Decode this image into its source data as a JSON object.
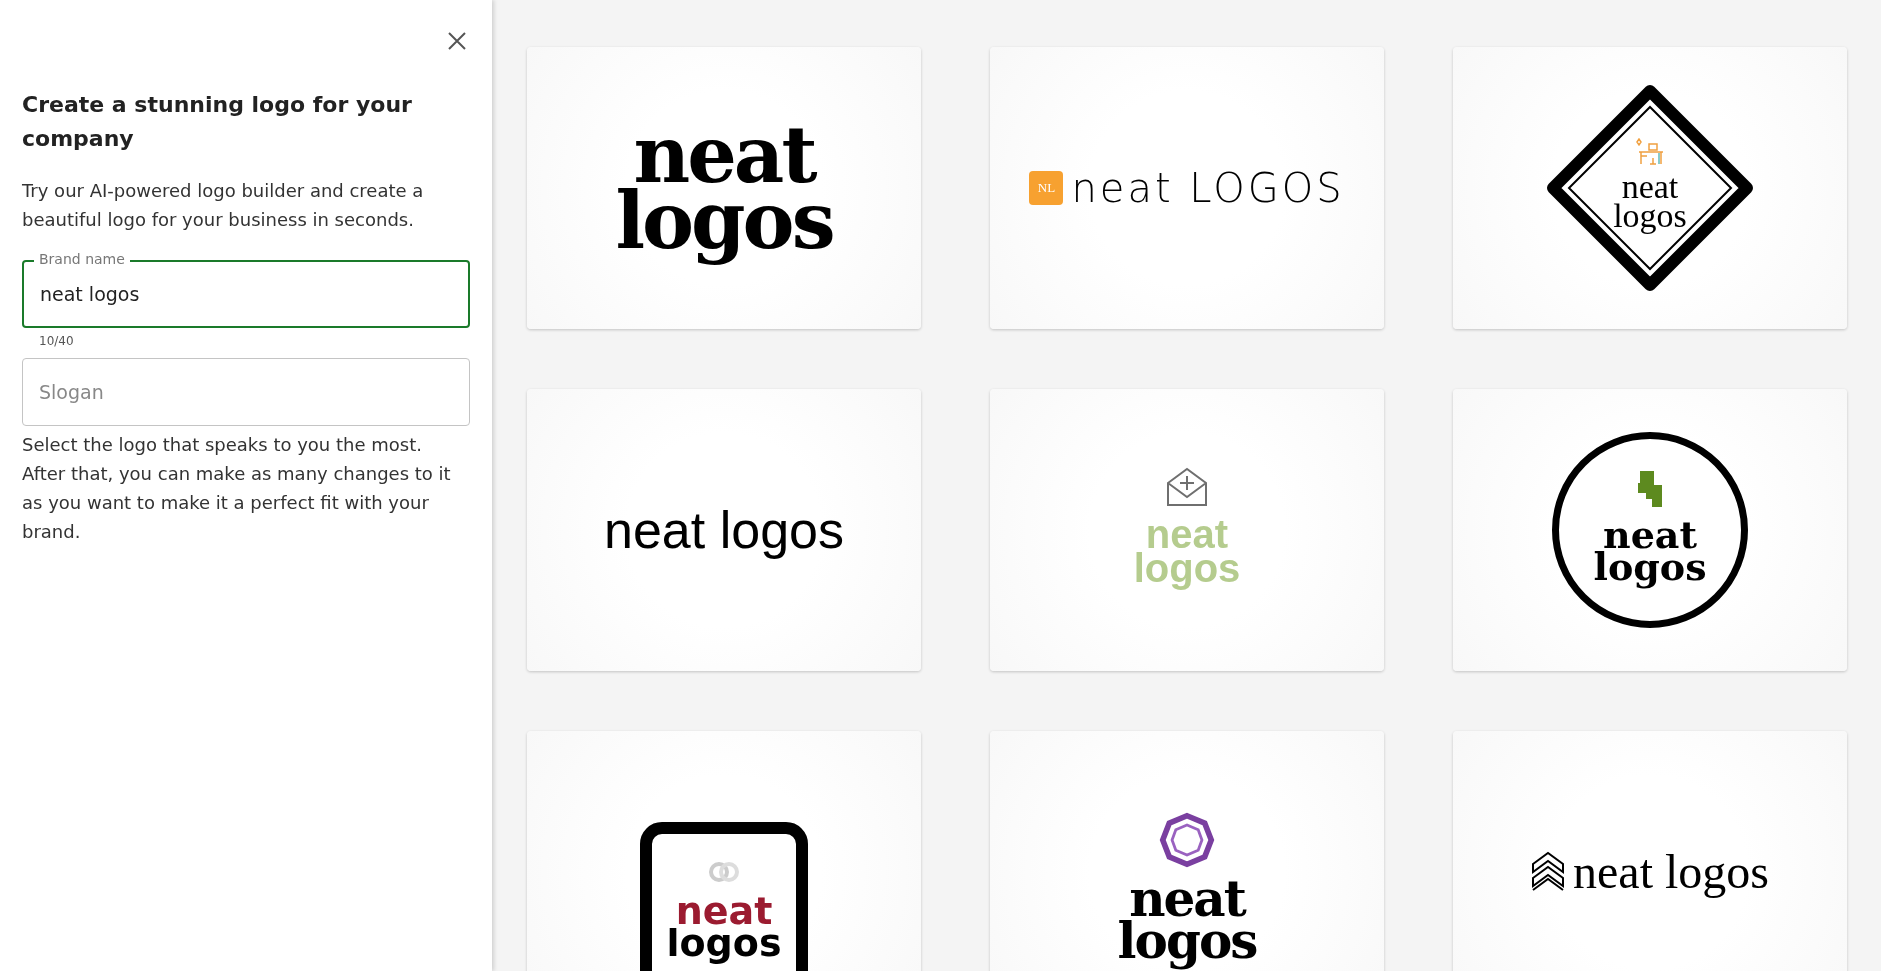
{
  "panel": {
    "title": "Create a stunning logo for your company",
    "intro": "Try our AI-powered logo builder and create a beautiful logo for your business in seconds.",
    "brand_field": {
      "label": "Brand name",
      "value": "neat logos",
      "counter": "10/40",
      "focused": true
    },
    "slogan_field": {
      "placeholder": "Slogan"
    },
    "hint": "Select the logo that speaks to you the most. After that, you can make as many changes to it as you want to make it a perfect fit with your brand."
  },
  "logos": [
    {
      "kind": "serif-stacked",
      "lines": [
        "neat",
        "logos"
      ]
    },
    {
      "kind": "badge-inline",
      "badge": "NL",
      "lines": [
        "neat LOGOS"
      ]
    },
    {
      "kind": "diamond",
      "lines": [
        "neat",
        "logos"
      ]
    },
    {
      "kind": "plain",
      "lines": [
        "neat logos"
      ]
    },
    {
      "kind": "envelope",
      "lines": [
        "neat",
        "logos"
      ]
    },
    {
      "kind": "circle",
      "lines": [
        "neat",
        "logos"
      ]
    },
    {
      "kind": "frame",
      "lines": [
        "neat",
        "logos"
      ]
    },
    {
      "kind": "ring",
      "lines": [
        "neat",
        "logos"
      ]
    },
    {
      "kind": "chevron",
      "lines": [
        "neat logos"
      ]
    }
  ]
}
